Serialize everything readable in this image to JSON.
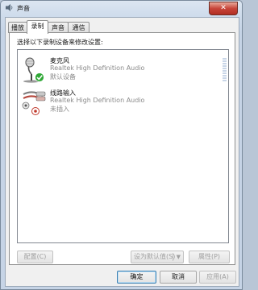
{
  "window": {
    "title": "声音",
    "close_label": "✕"
  },
  "tabs": [
    {
      "label": "播放",
      "active": false
    },
    {
      "label": "录制",
      "active": true
    },
    {
      "label": "声音",
      "active": false
    },
    {
      "label": "通信",
      "active": false
    }
  ],
  "prompt": "选择以下录制设备来修改设置:",
  "devices": [
    {
      "name": "麦克风",
      "driver": "Realtek High Definition Audio",
      "status": "默认设备",
      "icon": "microphone-icon",
      "badge": "default-check-icon"
    },
    {
      "name": "线路输入",
      "driver": "Realtek High Definition Audio",
      "status": "未插入",
      "icon": "line-in-jack-icon",
      "badge": "unplugged-icon"
    }
  ],
  "panel_buttons": {
    "configure": "配置(C)",
    "set_default": "设为默认值(S)",
    "set_default_arrow": "▼",
    "properties": "属性(P)"
  },
  "dialog_buttons": {
    "ok": "确定",
    "cancel": "取消",
    "apply": "应用(A)"
  },
  "colors": {
    "accent_check": "#2fa836",
    "close_red": "#c7453a",
    "badge_red": "#c0392b"
  }
}
